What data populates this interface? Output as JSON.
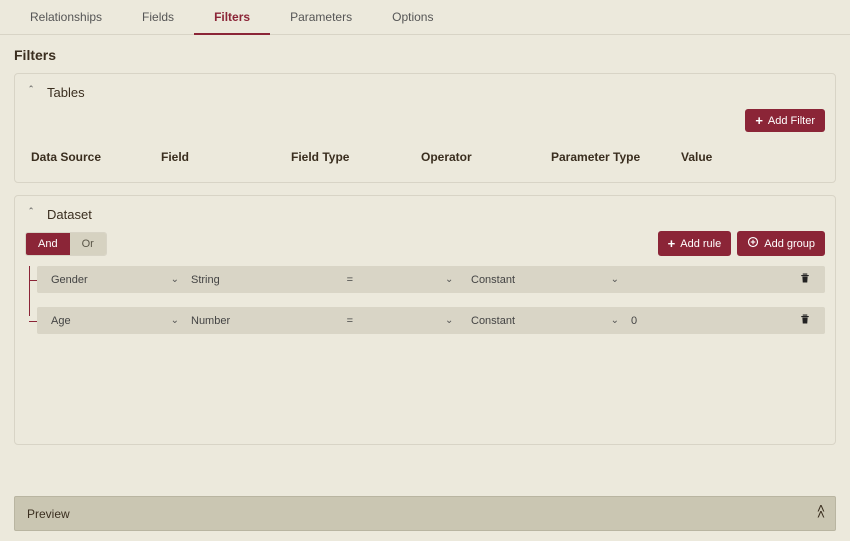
{
  "tabs": {
    "items": [
      {
        "label": "Relationships"
      },
      {
        "label": "Fields"
      },
      {
        "label": "Filters"
      },
      {
        "label": "Parameters"
      },
      {
        "label": "Options"
      }
    ],
    "active_index": 2
  },
  "page_title": "Filters",
  "sections": {
    "tables": {
      "title": "Tables",
      "add_filter_label": "Add Filter",
      "columns": {
        "data_source": "Data Source",
        "field": "Field",
        "field_type": "Field Type",
        "operator": "Operator",
        "parameter_type": "Parameter Type",
        "value": "Value"
      }
    },
    "dataset": {
      "title": "Dataset",
      "and_label": "And",
      "or_label": "Or",
      "logic_selected": "And",
      "add_rule_label": "Add rule",
      "add_group_label": "Add group",
      "rules": [
        {
          "field": "Gender",
          "type": "String",
          "operator": "=",
          "param_type": "Constant",
          "value": ""
        },
        {
          "field": "Age",
          "type": "Number",
          "operator": "=",
          "param_type": "Constant",
          "value": "0"
        }
      ]
    }
  },
  "preview_label": "Preview",
  "colors": {
    "accent": "#8b2537",
    "bg": "#ece9dc",
    "row": "#d9d5c6",
    "preview_bar": "#cac6b2"
  }
}
